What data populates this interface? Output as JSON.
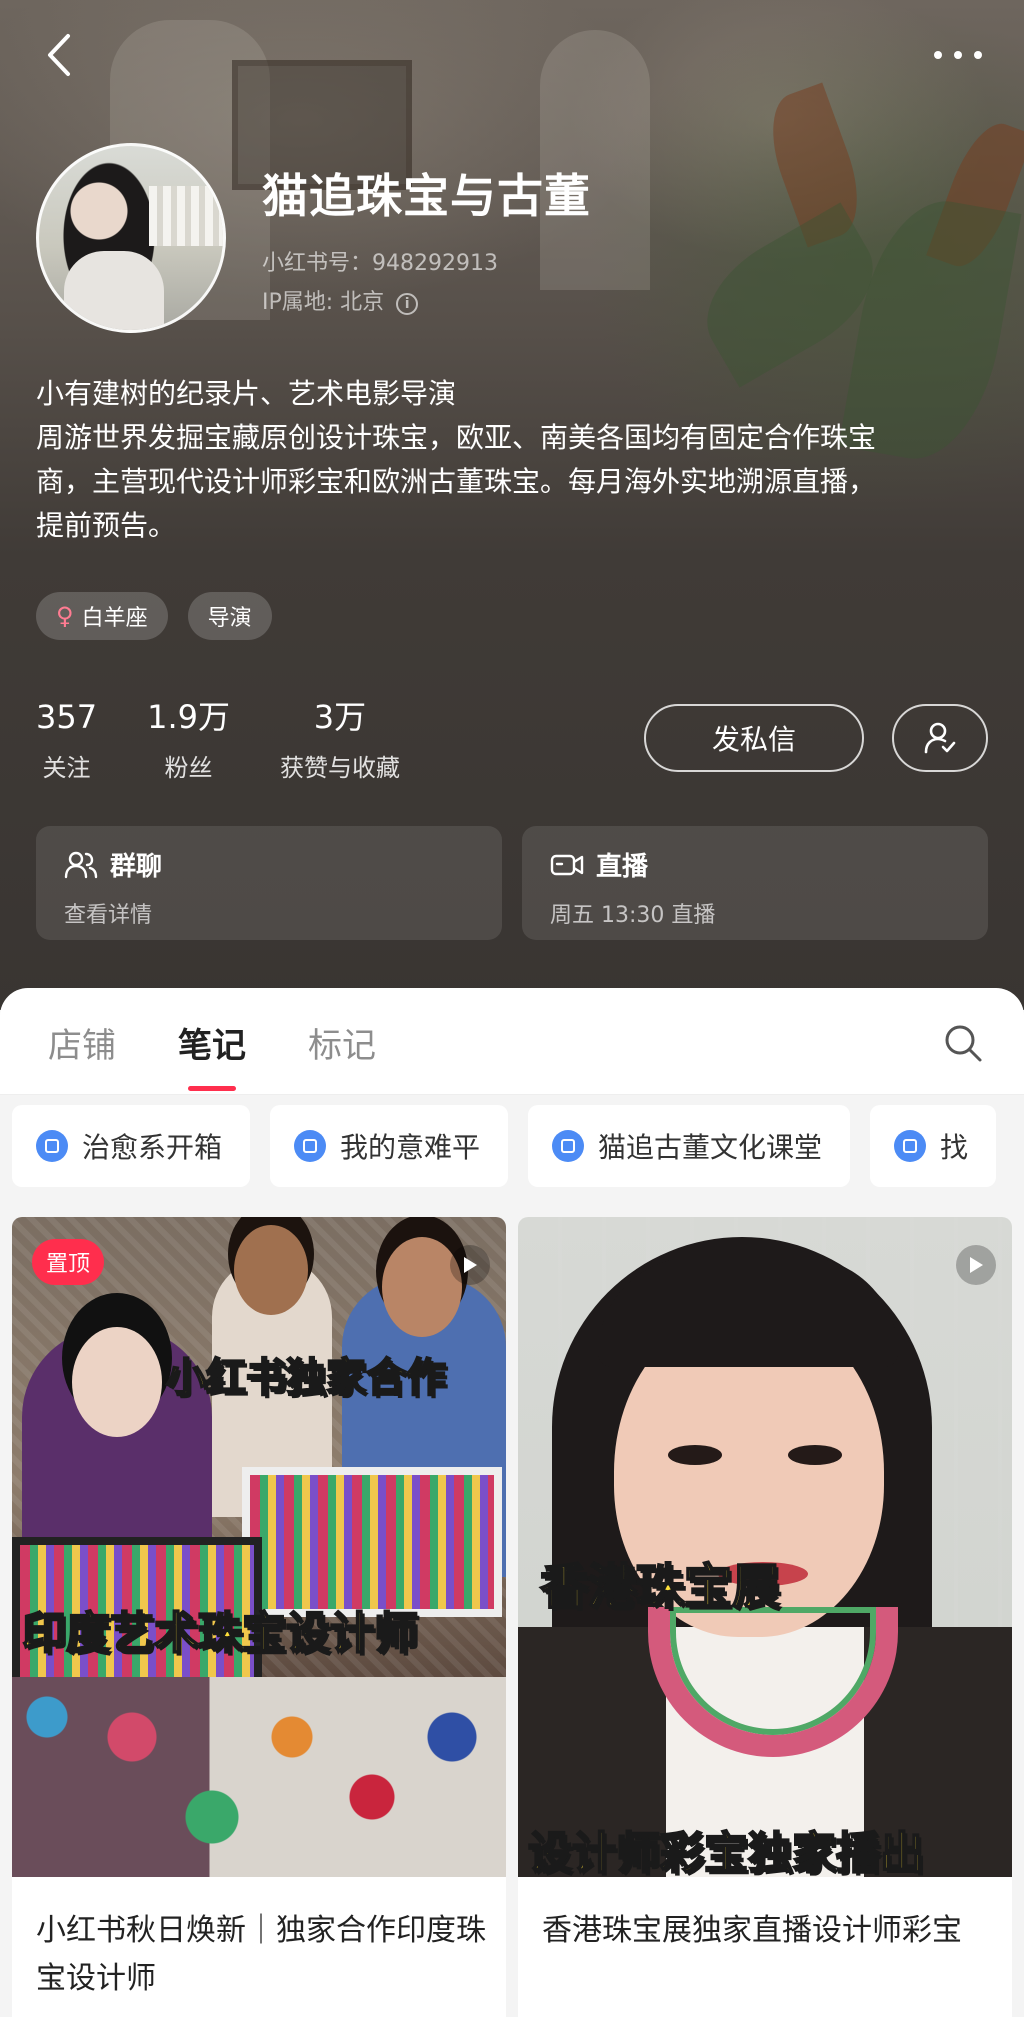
{
  "profile": {
    "name": "猫追珠宝与古董",
    "redbook_id": "小红书号：948292913",
    "ip_location": "IP属地: 北京",
    "bio_lines": [
      "小有建树的纪录片、艺术电影导演",
      "周游世界发掘宝藏原创设计珠宝，欧亚、南美各国均有固定合作珠宝",
      "商，主营现代设计师彩宝和欧洲古董珠宝。每月海外实地溯源直播，",
      "提前预告。"
    ],
    "tags": [
      {
        "label": "白羊座",
        "icon": "female-icon"
      },
      {
        "label": "导演"
      }
    ]
  },
  "stats": [
    {
      "value": "357",
      "label": "关注"
    },
    {
      "value": "1.9万",
      "label": "粉丝"
    },
    {
      "value": "3万",
      "label": "获赞与收藏"
    }
  ],
  "actions": {
    "message_label": "发私信",
    "follow_icon": "user-check-icon"
  },
  "cards": {
    "group": {
      "title": "群聊",
      "subtitle": "查看详情",
      "icon": "group-icon"
    },
    "live": {
      "title": "直播",
      "subtitle": "周五 13:30 直播",
      "icon": "camera-icon"
    }
  },
  "tabs": [
    {
      "label": "店铺",
      "active": false
    },
    {
      "label": "笔记",
      "active": true
    },
    {
      "label": "标记",
      "active": false
    }
  ],
  "collections": [
    "治愈系开箱",
    "我的意难平",
    "猫追古董文化课堂",
    "找"
  ],
  "notes": [
    {
      "title": "小红书秋日焕新｜独家合作印度珠宝设计师",
      "pinned_label": "置顶",
      "cover_text": [
        "小红书独家合作",
        "印度艺术珠宝设计师"
      ],
      "type": "video"
    },
    {
      "title": "香港珠宝展独家直播设计师彩宝",
      "cover_text": [
        "香港珠宝展",
        "设计师彩宝独家播出"
      ],
      "type": "video"
    }
  ],
  "colors": {
    "accent": "#ff2e4d",
    "collection_icon": "#4c8bf5"
  }
}
